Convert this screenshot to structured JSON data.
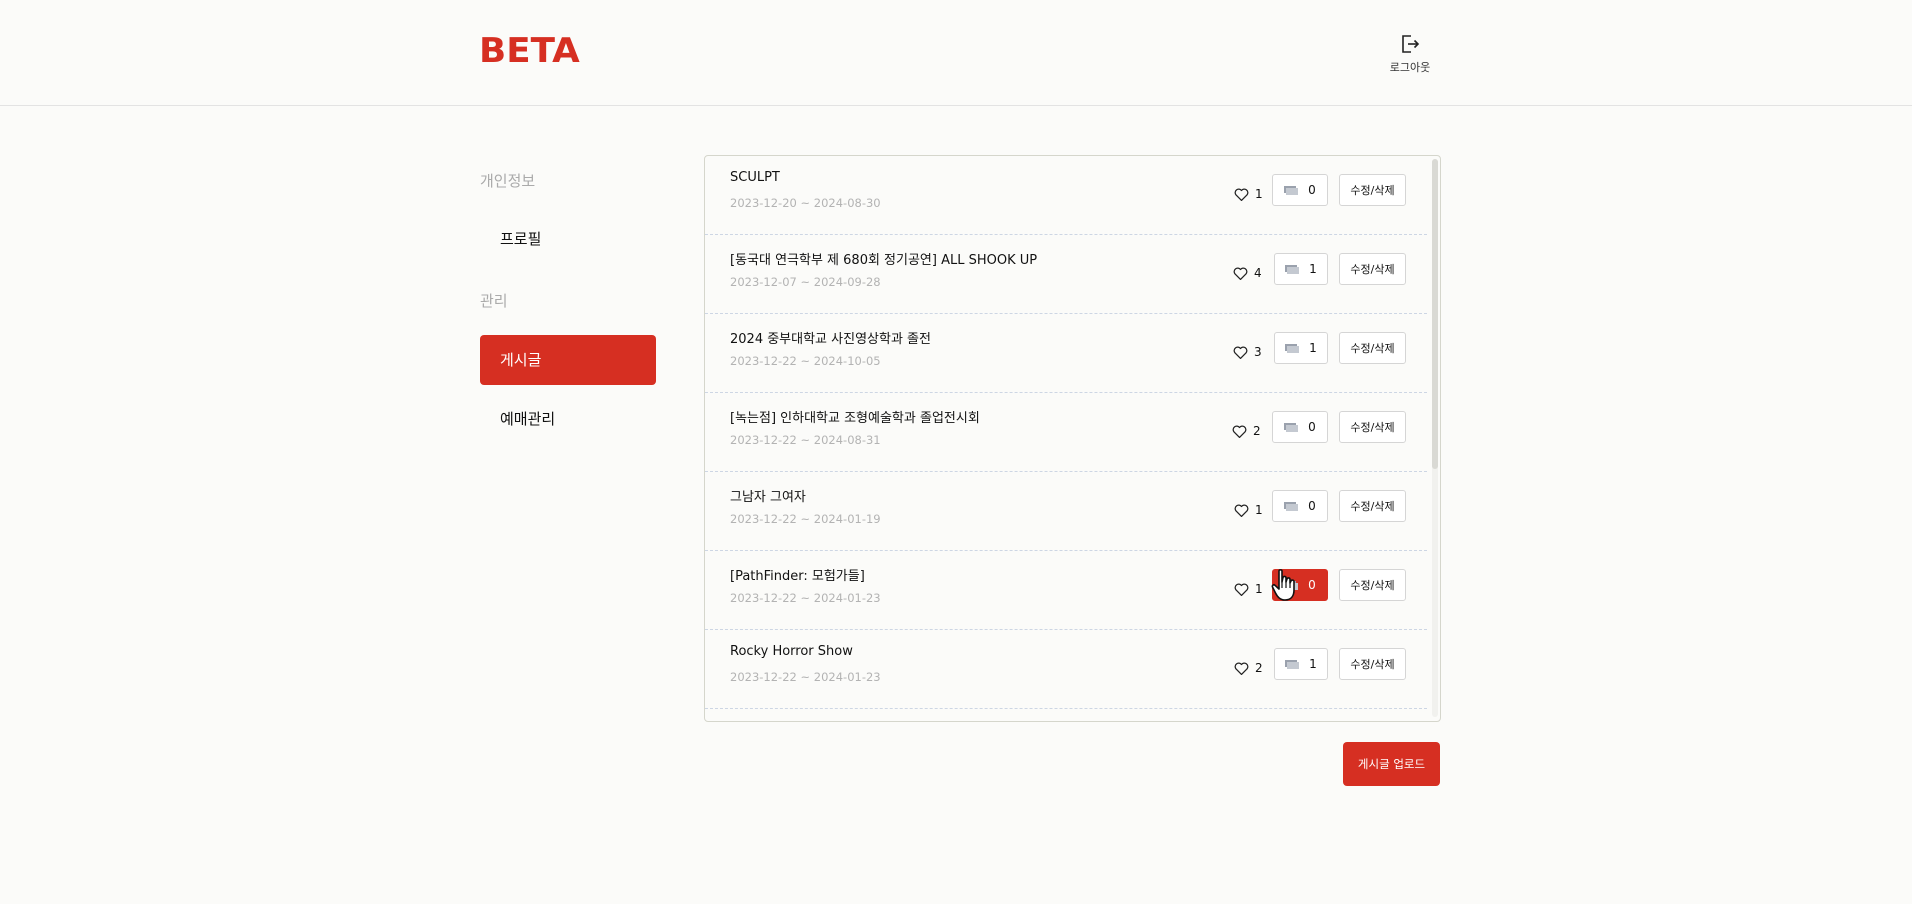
{
  "header": {
    "logo": "BETA",
    "logout_label": "로그아웃"
  },
  "sidebar": {
    "section_personal": "개인정보",
    "profile": "프로필",
    "section_manage": "관리",
    "posts": "게시글",
    "reservations": "예매관리"
  },
  "posts": [
    {
      "title": "SCULPT",
      "date": "2023-12-20 ~ 2024-08-30",
      "likes": "1",
      "comments": "0",
      "edit": "수정/삭제"
    },
    {
      "title": "[동국대 연극학부 제 680회 정기공연] ALL SHOOK UP",
      "date": "2023-12-07 ~ 2024-09-28",
      "likes": "4",
      "comments": "1",
      "edit": "수정/삭제"
    },
    {
      "title": "2024 중부대학교 사진영상학과 졸전",
      "date": "2023-12-22 ~ 2024-10-05",
      "likes": "3",
      "comments": "1",
      "edit": "수정/삭제"
    },
    {
      "title": "[녹는점] 인하대학교 조형예술학과 졸업전시회",
      "date": "2023-12-22 ~ 2024-08-31",
      "likes": "2",
      "comments": "0",
      "edit": "수정/삭제"
    },
    {
      "title": "그남자 그여자",
      "date": "2023-12-22 ~ 2024-01-19",
      "likes": "1",
      "comments": "0",
      "edit": "수정/삭제"
    },
    {
      "title": "[PathFinder: 모험가들]",
      "date": "2023-12-22 ~ 2024-01-23",
      "likes": "1",
      "comments": "0",
      "edit": "수정/삭제"
    },
    {
      "title": "Rocky Horror Show",
      "date": "2023-12-22 ~ 2024-01-23",
      "likes": "2",
      "comments": "1",
      "edit": "수정/삭제"
    }
  ],
  "upload_button": "게시글 업로드",
  "colors": {
    "accent": "#d62f22",
    "background": "#fbfbf9"
  }
}
